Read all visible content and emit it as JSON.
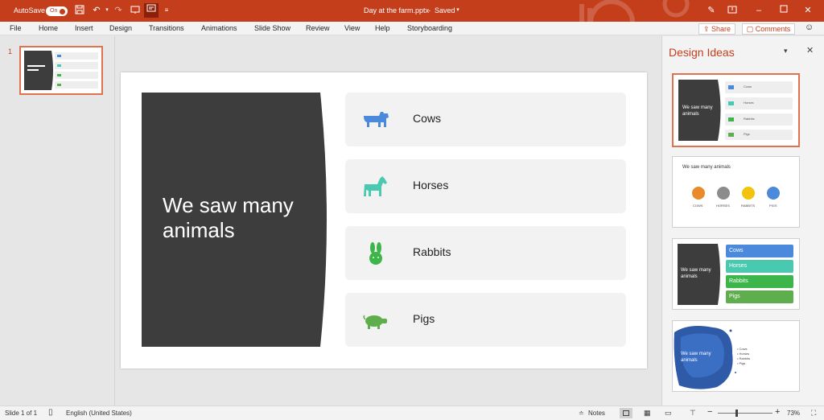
{
  "titlebar": {
    "autosave_label": "AutoSave",
    "autosave_state": "On",
    "doc_title": "Day at the farm.pptx",
    "save_status": "Saved",
    "icons": [
      "save-icon",
      "undo-icon",
      "redo-icon",
      "slideshow-icon",
      "customize-icon",
      "pen-icon",
      "ribbon-display-icon",
      "minimize-icon",
      "maximize-icon",
      "close-icon"
    ]
  },
  "menu": {
    "items": [
      "File",
      "Home",
      "Insert",
      "Design",
      "Transitions",
      "Animations",
      "Slide Show",
      "Review",
      "View",
      "Help",
      "Storyboarding"
    ],
    "share_label": "Share",
    "comments_label": "Comments"
  },
  "thumbnails": {
    "slide_number": "1"
  },
  "slide": {
    "title": "We saw many animals",
    "items": [
      {
        "label": "Cows",
        "icon": "cow-icon",
        "color": "#4a89dc"
      },
      {
        "label": "Horses",
        "icon": "horse-icon",
        "color": "#48c9b0"
      },
      {
        "label": "Rabbits",
        "icon": "rabbit-icon",
        "color": "#3cb54a"
      },
      {
        "label": "Pigs",
        "icon": "pig-icon",
        "color": "#5fae4e"
      }
    ],
    "dark_color": "#3d3d3d"
  },
  "design_ideas": {
    "title": "Design Ideas",
    "card2": {
      "heading": "We saw many animals",
      "labels": [
        "COWS",
        "HORSES",
        "RABBITS",
        "PIGS"
      ],
      "colors": [
        "#e98b2a",
        "#8c8c8c",
        "#f2c20f",
        "#4a89dc"
      ]
    },
    "card3": {
      "title": "We saw many animals",
      "bars": [
        "Cows",
        "Horses",
        "Rabbits",
        "Pigs"
      ]
    },
    "card4": {
      "title": "We saw many animals",
      "bullets": [
        "Cows",
        "Horses",
        "Rabbits",
        "Pigs"
      ]
    }
  },
  "status": {
    "slide_info": "Slide 1 of 1",
    "language": "English (United States)",
    "notes_label": "Notes",
    "zoom": "73%"
  },
  "colors": {
    "accent": "#c43e1c",
    "selection": "#e0724f"
  }
}
